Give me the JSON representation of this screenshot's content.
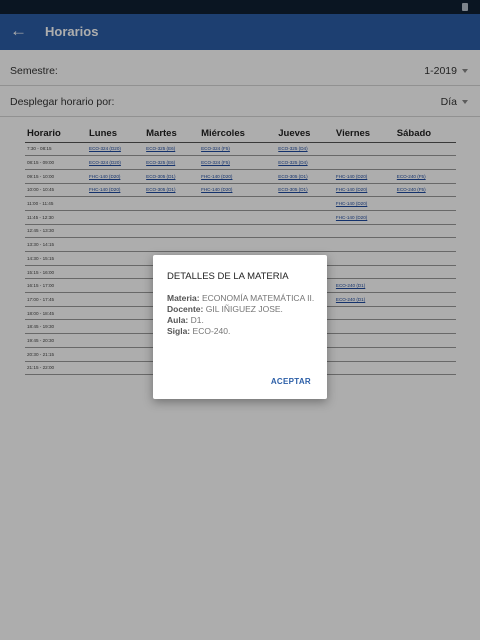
{
  "status": {
    "text": ""
  },
  "app_bar": {
    "title": "Horarios"
  },
  "settings": {
    "semester_label": "Semestre:",
    "semester_value": "1-2019",
    "display_label": "Desplegar horario por:",
    "display_value": "Día"
  },
  "schedule": {
    "headers": [
      "Horario",
      "Lunes",
      "Martes",
      "Miércoles",
      "Jueves",
      "Viernes",
      "Sábado"
    ],
    "rows": [
      [
        "7:30 - 08:15",
        "ECO-324 (D20)",
        "ECO-325 (E6)",
        "ECO-324 (F5)",
        "ECO-325 (D4)",
        "",
        ""
      ],
      [
        "08:15 - 09:00",
        "ECO-324 (D20)",
        "ECO-325 (E6)",
        "ECO-324 (F5)",
        "ECO-325 (D4)",
        "",
        ""
      ],
      [
        "09:15 - 10:00",
        "FHC-140 (D20)",
        "ECO-305 (D1)",
        "FHC-140 (D20)",
        "ECO-305 (D1)",
        "FHC-140 (D20)",
        "ECO-240 (F5)"
      ],
      [
        "10:00 - 10:45",
        "FHC-140 (D20)",
        "ECO-305 (D1)",
        "FHC-140 (D20)",
        "ECO-305 (D1)",
        "FHC-140 (D20)",
        "ECO-240 (F5)"
      ],
      [
        "11:00 - 11:45",
        "",
        "",
        "",
        "",
        "FHC-140 (D20)",
        ""
      ],
      [
        "11:45 - 12:30",
        "",
        "",
        "",
        "",
        "FHC-140 (D20)",
        ""
      ],
      [
        "12:45 - 13:30",
        "",
        "",
        "",
        "",
        "",
        ""
      ],
      [
        "13:30 - 14:15",
        "",
        "",
        "",
        "",
        "",
        ""
      ],
      [
        "14:30 - 15:15",
        "",
        "",
        "",
        "",
        "",
        ""
      ],
      [
        "15:15 - 16:00",
        "",
        "",
        "",
        "",
        "",
        ""
      ],
      [
        "16:15 - 17:00",
        "",
        "",
        "",
        "",
        "ECO-240 (D1)",
        ""
      ],
      [
        "17:00 - 17:45",
        "",
        "",
        "",
        "",
        "ECO-240 (D1)",
        ""
      ],
      [
        "18:00 - 18:45",
        "",
        "",
        "",
        "",
        "",
        ""
      ],
      [
        "18:45 - 19:30",
        "",
        "",
        "",
        "",
        "",
        ""
      ],
      [
        "19:45 - 20:30",
        "",
        "",
        "",
        "",
        "",
        ""
      ],
      [
        "20:30 - 21:15",
        "",
        "",
        "",
        "",
        "",
        ""
      ],
      [
        "21:15 - 22:00",
        "",
        "",
        "",
        "",
        "",
        ""
      ]
    ]
  },
  "dialog": {
    "title": "DETALLES DE LA MATERIA",
    "materia_label": "Materia:",
    "materia_value": "ECONOMÍA MATEMÁTICA II.",
    "docente_label": "Docente:",
    "docente_value": "GIL IÑIGUEZ JOSE.",
    "aula_label": "Aula:",
    "aula_value": "D1.",
    "sigla_label": "Sigla:",
    "sigla_value": "ECO-240.",
    "button_label": "ACEPTAR"
  },
  "colors": {
    "app_bar": "#2b5ea7",
    "status_bar": "#0f1f33",
    "link": "#1e4aa0",
    "accent": "#2b5ea7"
  },
  "icons": {
    "back": "arrow-left-icon",
    "dropdown": "caret-down-icon",
    "battery": "battery-icon"
  }
}
